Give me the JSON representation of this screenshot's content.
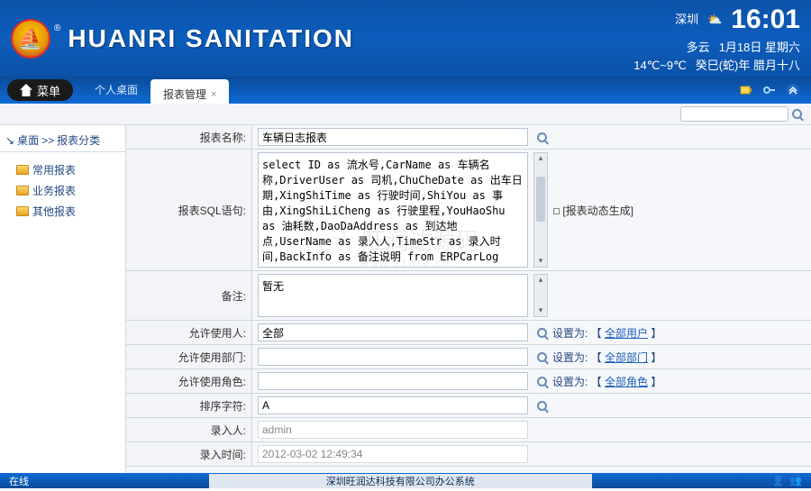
{
  "header": {
    "app_title": "HUANRI SANITATION",
    "city": "深圳",
    "weather": "多云",
    "temp": "14℃~9℃",
    "time": "16:01",
    "date": "1月18日 星期六",
    "lunar": "癸巳(蛇)年 腊月十八"
  },
  "nav": {
    "menu": "菜单",
    "tab_personal": "个人桌面",
    "tab_report": "报表管理",
    "close_x": "×"
  },
  "crumb": {
    "a": "桌面",
    "sep": ">>",
    "b": "报表分类"
  },
  "tree": [
    "常用报表",
    "业务报表",
    "其他报表"
  ],
  "labels": {
    "name": "报表名称:",
    "sql": "报表SQL语句:",
    "dyn": "[报表动态生成]",
    "note": "备注:",
    "allow_user": "允许使用人:",
    "allow_dept": "允许使用部门:",
    "allow_role": "允许使用角色:",
    "sort": "排序字符:",
    "entry_user": "录入人:",
    "entry_time": "录入时间:"
  },
  "form": {
    "name": "车辆日志报表",
    "sql": "select ID as 流水号,CarName as 车辆名称,DriverUser as 司机,ChuCheDate as 出车日期,XingShiTime as 行驶时间,ShiYou as 事由,XingShiLiCheng as 行驶里程,YouHaoShu as 油耗数,DaoDaAddress as 到达地点,UserName as 录入人,TimeStr as 录入时间,BackInfo as 备注说明 from ERPCarLog",
    "note": "暂无",
    "allow_user": "全部",
    "allow_dept": "",
    "allow_role": "",
    "sort": "A",
    "entry_user": "admin",
    "entry_time": "2012-03-02 12:49:34"
  },
  "link": {
    "set_prefix": "设置为: 【 ",
    "all_user": "全部用户",
    "all_dept": "全部部门",
    "all_role": "全部角色",
    "set_suffix": " 】"
  },
  "footer": {
    "online": "在线",
    "company": "深圳旺润达科技有限公司办公系统"
  },
  "watermark": {
    "main": "☆ 旺润达源码",
    "sub": "www.szwrd.cn"
  }
}
